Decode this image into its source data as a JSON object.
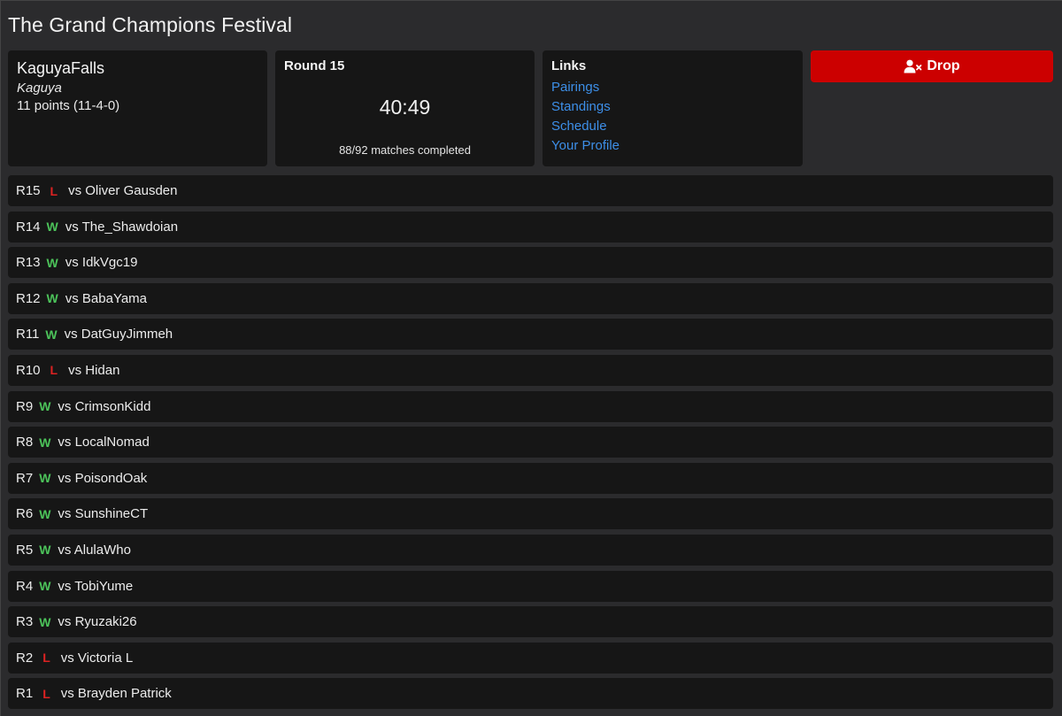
{
  "page": {
    "title": "The Grand Champions Festival"
  },
  "player": {
    "name": "KaguyaFalls",
    "character": "Kaguya",
    "points": "11 points (11-4-0)"
  },
  "round": {
    "heading": "Round 15",
    "timer": "40:49",
    "matches": "88/92 matches completed"
  },
  "links": {
    "heading": "Links",
    "items": [
      "Pairings",
      "Standings",
      "Schedule",
      "Your Profile"
    ]
  },
  "drop": {
    "label": "Drop",
    "icon": "user-remove-icon",
    "color": "#cc0000"
  },
  "colors": {
    "win": "#4cc35a",
    "loss": "#dd2222",
    "link": "#3d8fe8"
  },
  "rounds": [
    {
      "round": "R15",
      "result": "L",
      "opponent": "vs Oliver Gausden"
    },
    {
      "round": "R14",
      "result": "W",
      "opponent": "vs The_Shawdoian"
    },
    {
      "round": "R13",
      "result": "W",
      "opponent": "vs IdkVgc19"
    },
    {
      "round": "R12",
      "result": "W",
      "opponent": "vs BabaYama"
    },
    {
      "round": "R11",
      "result": "W",
      "opponent": "vs DatGuyJimmeh"
    },
    {
      "round": "R10",
      "result": "L",
      "opponent": "vs Hidan"
    },
    {
      "round": "R9",
      "result": "W",
      "opponent": "vs CrimsonKidd"
    },
    {
      "round": "R8",
      "result": "W",
      "opponent": "vs LocalNomad"
    },
    {
      "round": "R7",
      "result": "W",
      "opponent": "vs PoisondOak"
    },
    {
      "round": "R6",
      "result": "W",
      "opponent": "vs SunshineCT"
    },
    {
      "round": "R5",
      "result": "W",
      "opponent": "vs AlulaWho"
    },
    {
      "round": "R4",
      "result": "W",
      "opponent": "vs TobiYume"
    },
    {
      "round": "R3",
      "result": "W",
      "opponent": "vs Ryuzaki26"
    },
    {
      "round": "R2",
      "result": "L",
      "opponent": "vs Victoria L"
    },
    {
      "round": "R1",
      "result": "L",
      "opponent": "vs Brayden Patrick"
    }
  ]
}
